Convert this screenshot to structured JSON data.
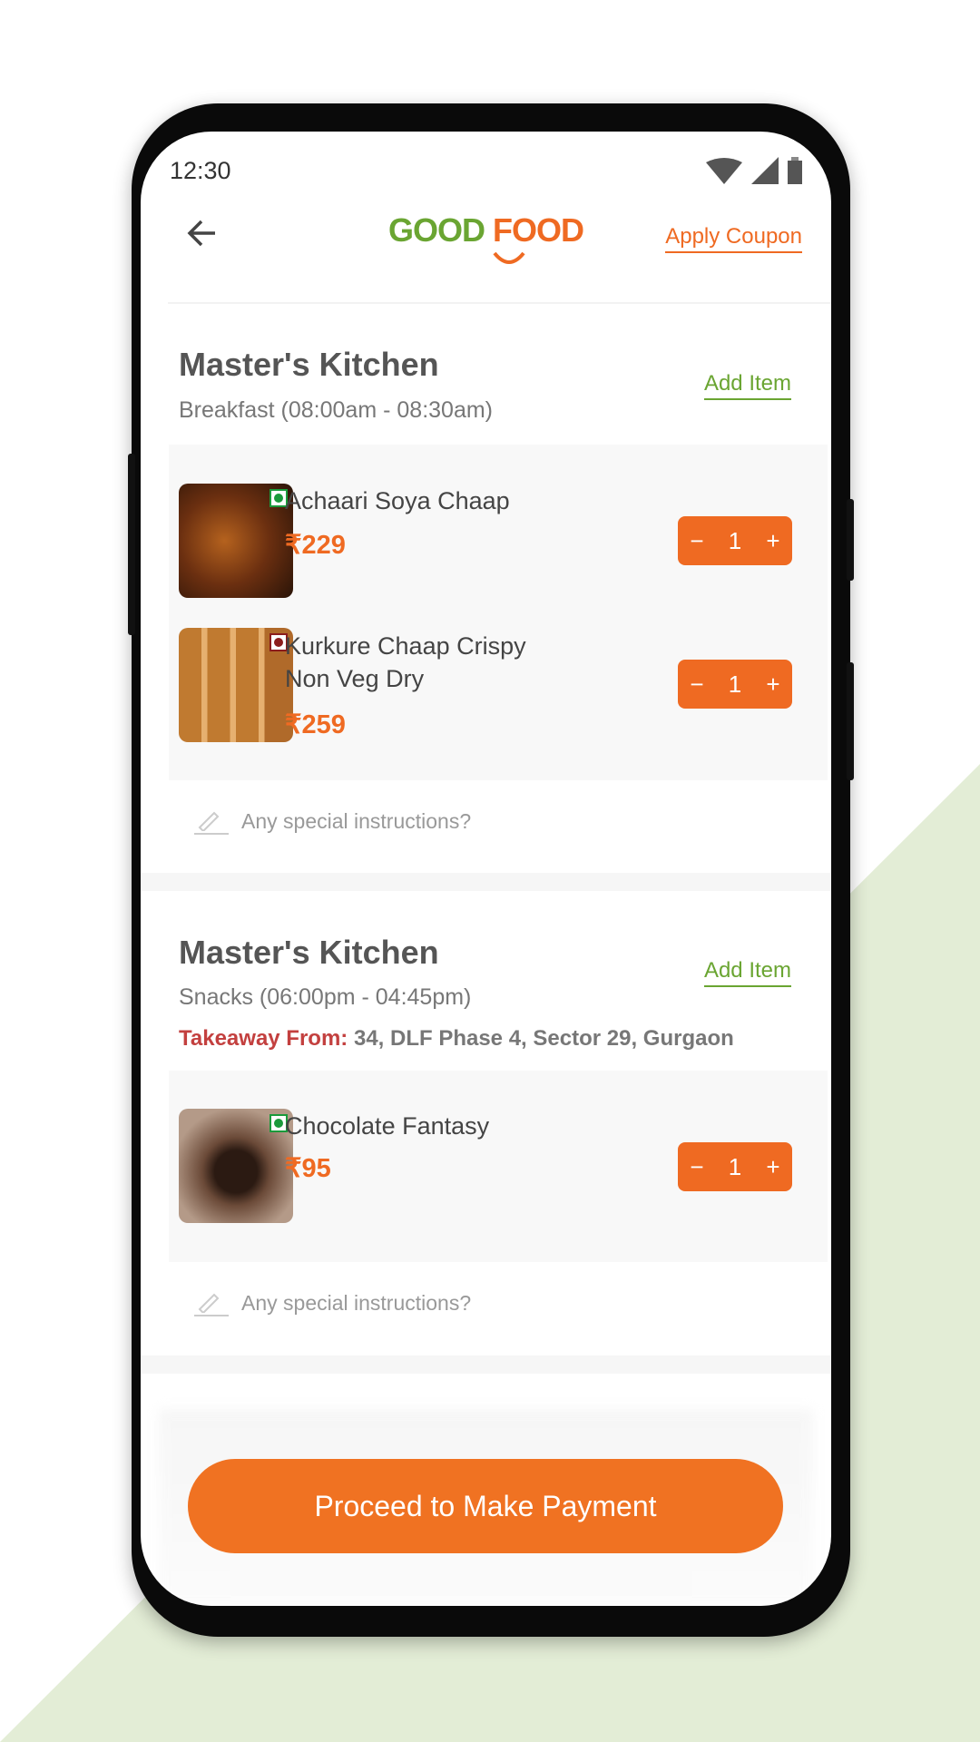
{
  "colors": {
    "brand_orange": "#ef6a22",
    "brand_green": "#6aa532",
    "takeaway_red": "#c3403f",
    "background_green": "#e3edd6"
  },
  "status_bar": {
    "time": "12:30",
    "icons": [
      "wifi-icon",
      "signal-icon",
      "battery-icon"
    ]
  },
  "header": {
    "back_icon": "arrow-left-icon",
    "logo_part1": "GOOD",
    "logo_part2": "FOOD",
    "apply_coupon": "Apply Coupon"
  },
  "sections": [
    {
      "kitchen": "Master's Kitchen",
      "meal": "Breakfast (08:00am - 08:30am)",
      "add_item": "Add Item",
      "items": [
        {
          "name": "Achaari Soya Chaap",
          "price": "₹229",
          "qty": "1",
          "type": "veg"
        },
        {
          "name": "Kurkure Chaap Crispy Non Veg Dry",
          "price": "₹259",
          "qty": "1",
          "type": "non-veg"
        }
      ],
      "instructions_placeholder": "Any special instructions?"
    },
    {
      "kitchen": "Master's Kitchen",
      "meal": "Snacks (06:00pm - 04:45pm)",
      "takeaway_label": "Takeaway From:",
      "takeaway_address": "34, DLF Phase 4, Sector 29, Gurgaon",
      "add_item": "Add Item",
      "items": [
        {
          "name": "Chocolate Fantasy",
          "price": "₹95",
          "qty": "1",
          "type": "veg"
        }
      ],
      "instructions_placeholder": "Any special instructions?"
    }
  ],
  "stepper": {
    "minus": "−",
    "plus": "+"
  },
  "footer": {
    "pay_button": "Proceed to Make Payment"
  }
}
